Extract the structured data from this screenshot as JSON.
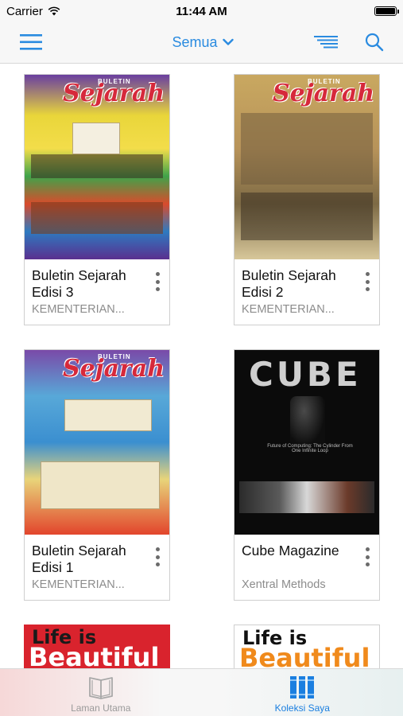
{
  "status_bar": {
    "carrier": "Carrier",
    "time": "11:44 AM"
  },
  "nav": {
    "filter_label": "Semua",
    "accent_color": "#2a8be0"
  },
  "books": [
    {
      "title": "Buletin Sejarah Edisi 3",
      "publisher": "KEMENTERIAN...",
      "cover_title": "Sejarah",
      "cover_kicker": "BULETIN"
    },
    {
      "title": "Buletin Sejarah Edisi 2",
      "publisher": "KEMENTERIAN...",
      "cover_title": "Sejarah",
      "cover_kicker": "BULETIN"
    },
    {
      "title": "Buletin Sejarah Edisi 1",
      "publisher": "KEMENTERIAN...",
      "cover_title": "Sejarah",
      "cover_kicker": "BULETIN"
    },
    {
      "title": "Cube Magazine",
      "publisher": "Xentral Methods",
      "cover_title": "CUBE",
      "cover_tagline": "Future of Computing: The Cylinder From One Infinite Loop"
    },
    {
      "cover_line1": "Life is",
      "cover_line2": "Beautiful"
    },
    {
      "cover_line1": "Life is",
      "cover_line2": "Beautiful"
    }
  ],
  "tabs": [
    {
      "label": "Laman Utama",
      "icon": "book-open-icon",
      "active": false
    },
    {
      "label": "Koleksi Saya",
      "icon": "library-icon",
      "active": true
    }
  ]
}
